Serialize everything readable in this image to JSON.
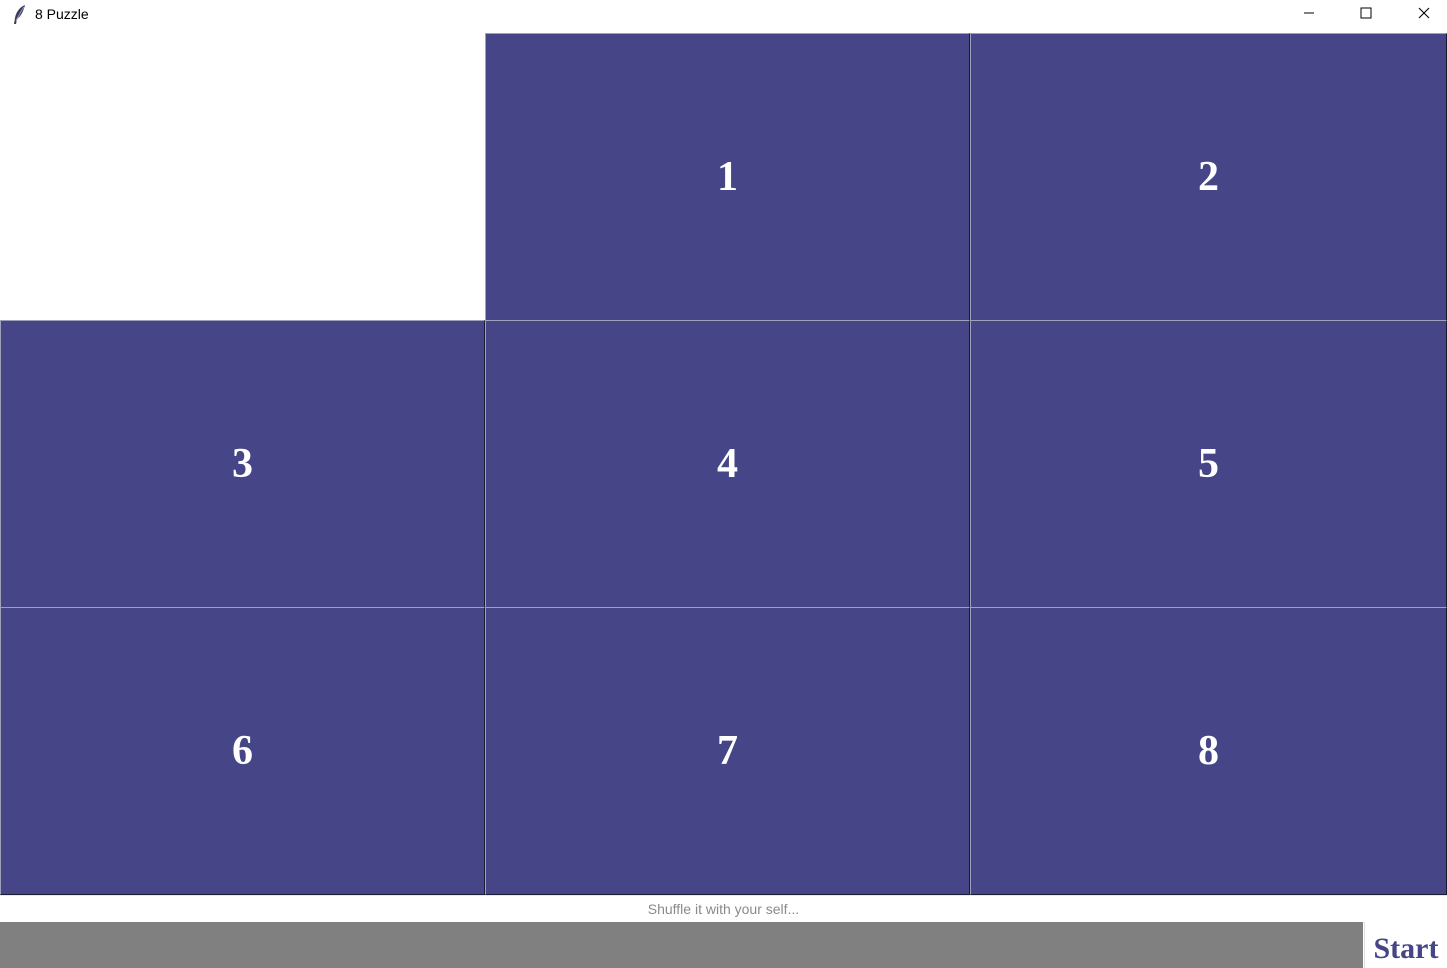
{
  "window": {
    "title": "8 Puzzle",
    "icon": "feather-icon",
    "controls": {
      "minimize_icon": "minimize-icon",
      "maximize_icon": "maximize-icon",
      "close_icon": "close-icon"
    }
  },
  "board": {
    "rows": 3,
    "cols": 3,
    "tiles": [
      {
        "label": "",
        "empty": true
      },
      {
        "label": "1"
      },
      {
        "label": "2"
      },
      {
        "label": "3"
      },
      {
        "label": "4"
      },
      {
        "label": "5"
      },
      {
        "label": "6"
      },
      {
        "label": "7"
      },
      {
        "label": "8"
      }
    ],
    "tile_color": "#454587",
    "text_color": "#ffffff"
  },
  "status": {
    "text": "Shuffle it with your self..."
  },
  "controls": {
    "start_label": "Start",
    "bar_color": "#808080"
  }
}
